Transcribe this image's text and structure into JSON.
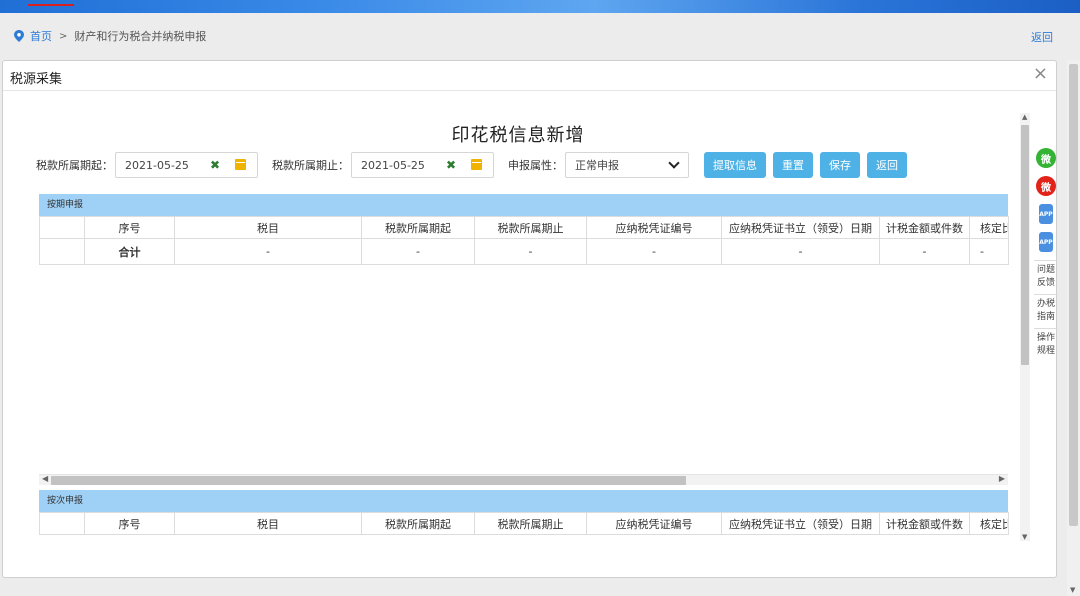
{
  "breadcrumb": {
    "home": "首页",
    "separator": ">",
    "current": "财产和行为税合并纳税申报",
    "back": "返回"
  },
  "modal": {
    "title": "税源采集",
    "close": "×"
  },
  "form": {
    "title": "印花税信息新增",
    "period_start_label": "税款所属期起：",
    "period_start_value": "2021-05-25",
    "period_end_label": "税款所属期止：",
    "period_end_value": "2021-05-25",
    "attr_label": "申报属性：",
    "attr_value": "正常申报",
    "buttons": {
      "fetch": "提取信息",
      "reset": "重置",
      "save": "保存",
      "back": "返回"
    }
  },
  "section_periodic": {
    "title": "按期申报",
    "columns": [
      "序号",
      "税目",
      "税款所属期起",
      "税款所属期止",
      "应纳税凭证编号",
      "应纳税凭证书立（领受）日期",
      "计税金额或件数",
      "核定比"
    ],
    "total_row": [
      "合计",
      "-",
      "-",
      "-",
      "-",
      "-",
      "-",
      "-"
    ]
  },
  "section_each": {
    "title": "按次申报",
    "columns": [
      "序号",
      "税目",
      "税款所属期起",
      "税款所属期止",
      "应纳税凭证编号",
      "应纳税凭证书立（领受）日期",
      "计税金额或件数",
      "核定比"
    ]
  },
  "side_tools": {
    "wechat": "微",
    "weibo": "微",
    "app1": "APP",
    "app2": "APP",
    "feedback": "问题反馈",
    "guide": "办税指南",
    "procedure": "操作规程"
  },
  "colors": {
    "accent_button": "#4fb2e6",
    "section_bar": "#9fd0f6",
    "link": "#2e7bd6"
  }
}
